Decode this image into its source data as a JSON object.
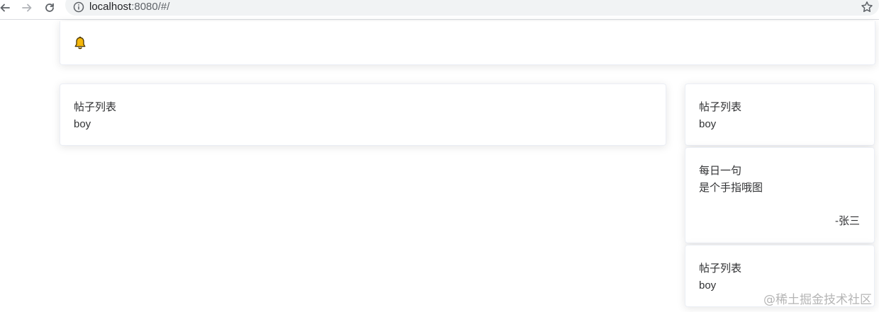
{
  "browser": {
    "url_host": "localhost",
    "url_path": ":8080/#/"
  },
  "icons": {
    "back": "arrow-left-icon",
    "forward": "arrow-right-icon",
    "reload": "reload-icon",
    "info": "info-icon",
    "star": "star-icon",
    "bell": "bell-icon"
  },
  "colors": {
    "bell": "#f5b70a",
    "card_border": "#ebeef5",
    "text": "#303133"
  },
  "main": {
    "post_list": {
      "title": "帖子列表",
      "body": "boy"
    }
  },
  "sidebar": {
    "post_list_1": {
      "title": "帖子列表",
      "body": "boy"
    },
    "daily_quote": {
      "title": "每日一句",
      "text": "是个手指哦图",
      "author": "-张三"
    },
    "post_list_2": {
      "title": "帖子列表",
      "body": "boy"
    }
  },
  "watermark": "@稀土掘金技术社区"
}
